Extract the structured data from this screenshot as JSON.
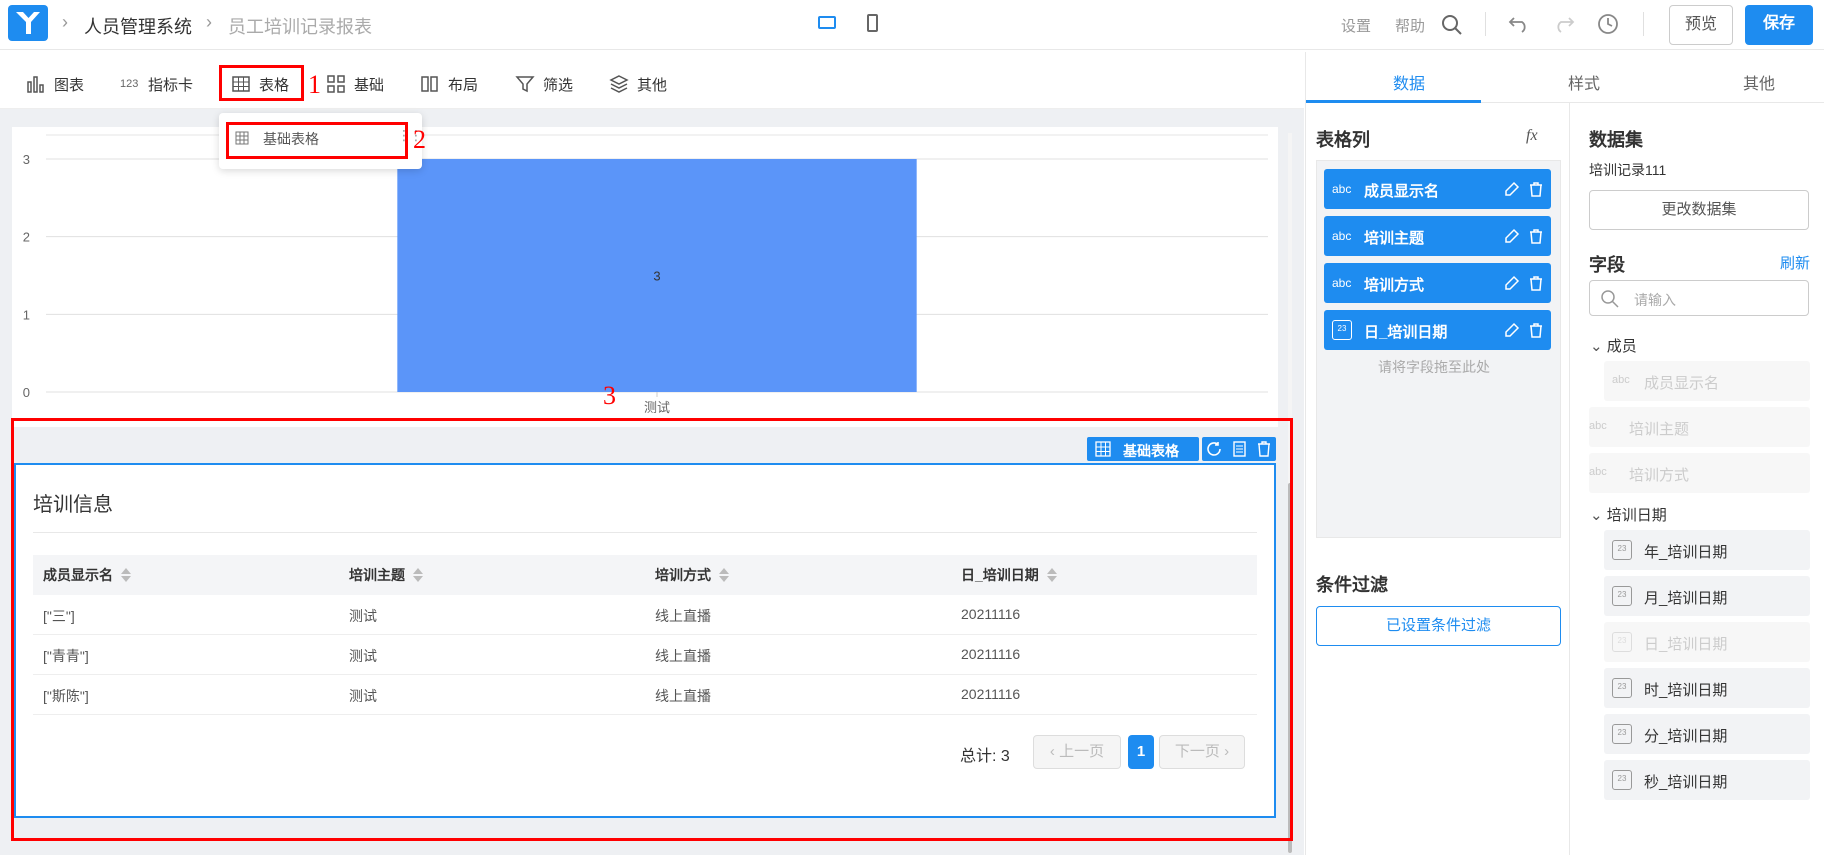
{
  "header": {
    "breadcrumb": [
      "人员管理系统",
      "员工培训记录报表"
    ],
    "settings": "设置",
    "help": "帮助",
    "preview": "预览",
    "save": "保存"
  },
  "toolbar": {
    "items": [
      "图表",
      "指标卡",
      "表格",
      "基础",
      "布局",
      "筛选",
      "其他"
    ],
    "indicator_icon_text": "123"
  },
  "dropdown": {
    "item": "基础表格"
  },
  "annotations": [
    "1",
    "2",
    "3"
  ],
  "chart_data": {
    "type": "bar",
    "categories": [
      "测试"
    ],
    "values": [
      3
    ],
    "data_labels": [
      "3"
    ],
    "ylim": [
      0,
      3
    ],
    "yticks": [
      "0",
      "1",
      "2",
      "3"
    ],
    "color": "#5b95f9"
  },
  "table_widget": {
    "tag": "基础表格",
    "title": "培训信息",
    "columns": [
      "成员显示名",
      "培训主题",
      "培训方式",
      "日_培训日期"
    ],
    "rows": [
      [
        "[\"三\"]",
        "测试",
        "线上直播",
        "20211116"
      ],
      [
        "[\"青青\"]",
        "测试",
        "线上直播",
        "20211116"
      ],
      [
        "[\"斯陈\"]",
        "测试",
        "线上直播",
        "20211116"
      ]
    ],
    "total": "总计: 3",
    "prev": "上一页",
    "page": "1",
    "next": "下一页"
  },
  "right_tabs": [
    "数据",
    "样式",
    "其他"
  ],
  "columns_panel": {
    "title": "表格列",
    "fx": "fx",
    "fields": [
      {
        "type": "abc",
        "label": "成员显示名"
      },
      {
        "type": "abc",
        "label": "培训主题"
      },
      {
        "type": "abc",
        "label": "培训方式"
      },
      {
        "type": "23",
        "label": "日_培训日期"
      }
    ],
    "drop_hint": "请将字段拖至此处",
    "filter_title": "条件过滤",
    "filter_button": "已设置条件过滤"
  },
  "dataset_panel": {
    "title": "数据集",
    "dataset_name": "培训记录111",
    "change_button": "更改数据集",
    "fields_title": "字段",
    "refresh": "刷新",
    "search_placeholder": "请输入",
    "groups": [
      {
        "name": "成员",
        "items": [
          {
            "type": "abc",
            "label": "成员显示名",
            "disabled": true
          }
        ]
      },
      {
        "name": "",
        "items": [
          {
            "type": "abc",
            "label": "培训主题",
            "disabled": true
          },
          {
            "type": "abc",
            "label": "培训方式",
            "disabled": true
          }
        ]
      },
      {
        "name": "培训日期",
        "items": [
          {
            "type": "23",
            "label": "年_培训日期",
            "disabled": false
          },
          {
            "type": "23",
            "label": "月_培训日期",
            "disabled": false
          },
          {
            "type": "23",
            "label": "日_培训日期",
            "disabled": true
          },
          {
            "type": "23",
            "label": "时_培训日期",
            "disabled": false
          },
          {
            "type": "23",
            "label": "分_培训日期",
            "disabled": false
          },
          {
            "type": "23",
            "label": "秒_培训日期",
            "disabled": false
          }
        ]
      }
    ]
  }
}
